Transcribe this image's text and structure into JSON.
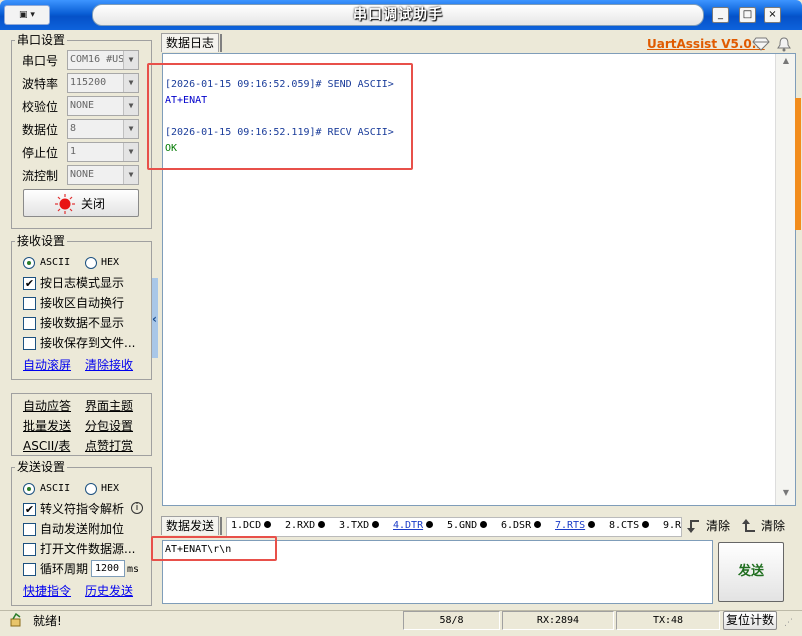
{
  "window": {
    "title": "串口调试助手",
    "sysmenu_label": "▣ ▾",
    "min_label": "_",
    "max_label": "□",
    "close_label": "×"
  },
  "serial_settings": {
    "title": "串口设置",
    "port_label": "串口号",
    "port_value": "COM16 #USB",
    "baud_label": "波特率",
    "baud_value": "115200",
    "parity_label": "校验位",
    "parity_value": "NONE",
    "databits_label": "数据位",
    "databits_value": "8",
    "stopbits_label": "停止位",
    "stopbits_value": "1",
    "flow_label": "流控制",
    "flow_value": "NONE",
    "close_button": "关闭"
  },
  "receive_settings": {
    "title": "接收设置",
    "ascii_label": "ASCII",
    "hex_label": "HEX",
    "log_mode_label": "按日志模式显示",
    "log_mode_checked": "✔",
    "auto_wrap_label": "接收区自动换行",
    "hide_data_label": "接收数据不显示",
    "save_file_label": "接收保存到文件...",
    "auto_scroll_link": "自动滚屏",
    "clear_recv_link": "清除接收"
  },
  "tools": {
    "auto_reply": "自动应答",
    "theme": "界面主题",
    "batch_send": "批量发送",
    "split_settings": "分包设置",
    "ascii_table": "ASCII/表",
    "tip": "点赞打赏"
  },
  "send_settings": {
    "title": "发送设置",
    "ascii_label": "ASCII",
    "hex_label": "HEX",
    "escape_label": "转义符指令解析",
    "escape_checked": "✔",
    "append_label": "自动发送附加位",
    "open_file_label": "打开文件数据源...",
    "cycle_label": "循环周期",
    "cycle_value": "1200",
    "cycle_unit": "ms",
    "shortcut_link": "快捷指令",
    "history_link": "历史发送"
  },
  "log_panel": {
    "tab_label": "数据日志",
    "brand": "UartAssist V5.0.2",
    "lines": [
      {
        "text": "[2026-01-15 09:16:52.059]# SEND ASCII>",
        "color": "#1a3c9a"
      },
      {
        "text": "AT+ENAT",
        "color": "#0000cc"
      },
      {
        "text": "[2026-01-15 09:16:52.119]# RECV ASCII>",
        "color": "#1a3c9a"
      },
      {
        "text": "OK",
        "color": "#007a00"
      }
    ]
  },
  "send_panel": {
    "tab_label": "数据发送",
    "signals": [
      "1.DCD",
      "2.RXD",
      "3.TXD",
      "4.DTR",
      "5.GND",
      "6.DSR",
      "7.RTS",
      "8.CTS",
      "9.R"
    ],
    "clear1": "清除",
    "clear2": "清除",
    "input_value": "AT+ENAT\\r\\n",
    "send_button": "发送"
  },
  "status": {
    "ready": "就绪!",
    "counter": "58/8",
    "rx": "RX:2894",
    "tx": "TX:48",
    "reset_button": "复位计数"
  }
}
